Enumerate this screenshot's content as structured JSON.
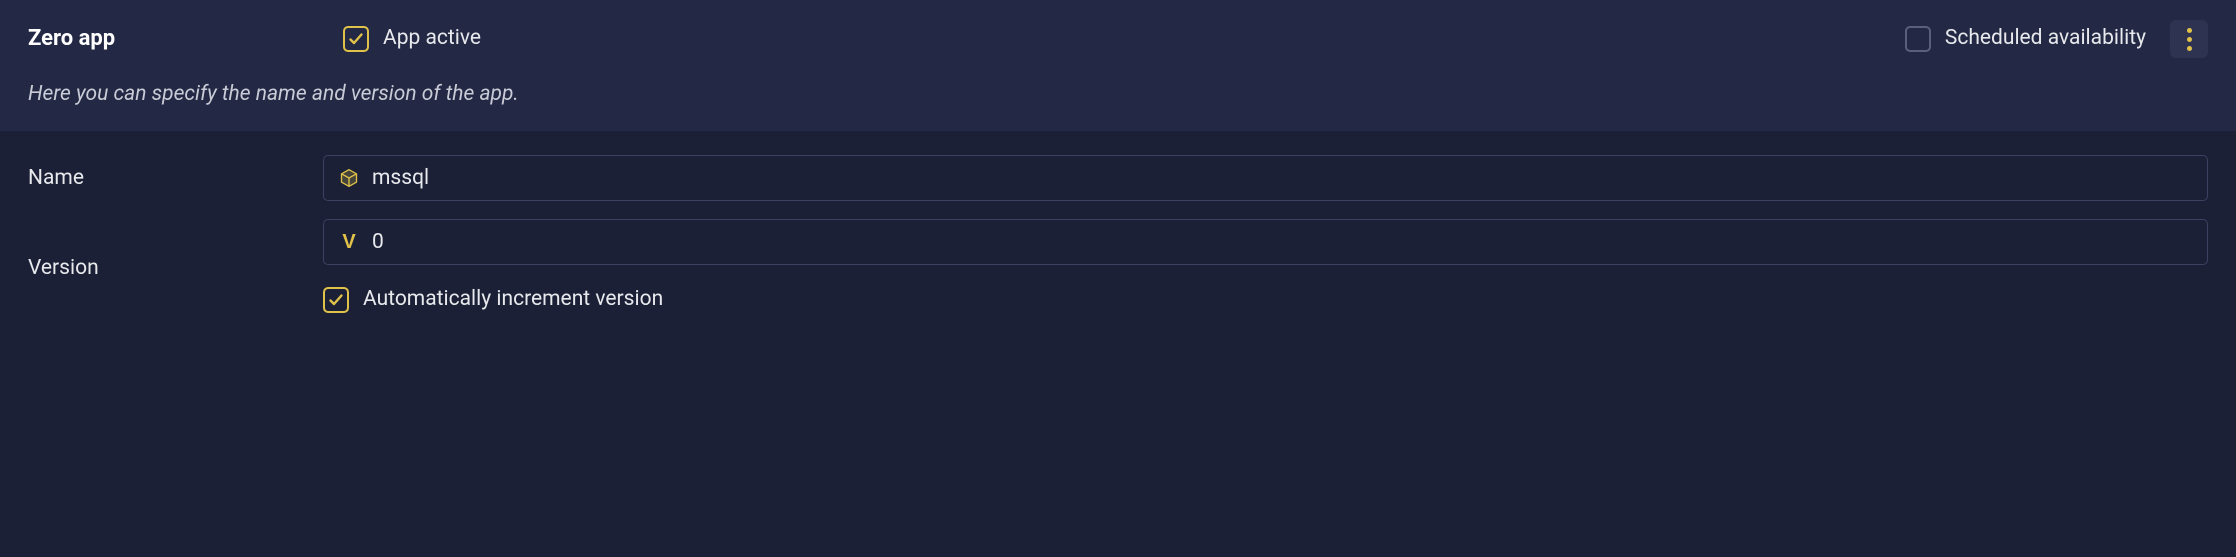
{
  "header": {
    "title": "Zero app",
    "app_active_label": "App active",
    "app_active_checked": true,
    "scheduled_label": "Scheduled availability",
    "scheduled_checked": false,
    "subtitle": "Here you can specify the name and version of the app."
  },
  "form": {
    "name_label": "Name",
    "name_value": "mssql",
    "version_label": "Version",
    "version_value": "0",
    "version_prefix": "V",
    "auto_increment_label": "Automatically increment version",
    "auto_increment_checked": true
  }
}
